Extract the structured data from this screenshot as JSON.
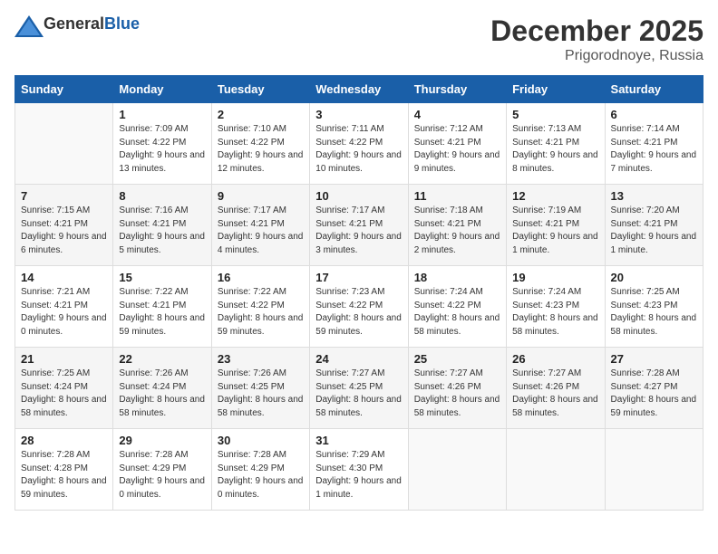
{
  "header": {
    "logo_general": "General",
    "logo_blue": "Blue",
    "month": "December 2025",
    "location": "Prigorodnoye, Russia"
  },
  "weekdays": [
    "Sunday",
    "Monday",
    "Tuesday",
    "Wednesday",
    "Thursday",
    "Friday",
    "Saturday"
  ],
  "weeks": [
    [
      {
        "day": "",
        "sunrise": "",
        "sunset": "",
        "daylight": ""
      },
      {
        "day": "1",
        "sunrise": "Sunrise: 7:09 AM",
        "sunset": "Sunset: 4:22 PM",
        "daylight": "Daylight: 9 hours and 13 minutes."
      },
      {
        "day": "2",
        "sunrise": "Sunrise: 7:10 AM",
        "sunset": "Sunset: 4:22 PM",
        "daylight": "Daylight: 9 hours and 12 minutes."
      },
      {
        "day": "3",
        "sunrise": "Sunrise: 7:11 AM",
        "sunset": "Sunset: 4:22 PM",
        "daylight": "Daylight: 9 hours and 10 minutes."
      },
      {
        "day": "4",
        "sunrise": "Sunrise: 7:12 AM",
        "sunset": "Sunset: 4:21 PM",
        "daylight": "Daylight: 9 hours and 9 minutes."
      },
      {
        "day": "5",
        "sunrise": "Sunrise: 7:13 AM",
        "sunset": "Sunset: 4:21 PM",
        "daylight": "Daylight: 9 hours and 8 minutes."
      },
      {
        "day": "6",
        "sunrise": "Sunrise: 7:14 AM",
        "sunset": "Sunset: 4:21 PM",
        "daylight": "Daylight: 9 hours and 7 minutes."
      }
    ],
    [
      {
        "day": "7",
        "sunrise": "Sunrise: 7:15 AM",
        "sunset": "Sunset: 4:21 PM",
        "daylight": "Daylight: 9 hours and 6 minutes."
      },
      {
        "day": "8",
        "sunrise": "Sunrise: 7:16 AM",
        "sunset": "Sunset: 4:21 PM",
        "daylight": "Daylight: 9 hours and 5 minutes."
      },
      {
        "day": "9",
        "sunrise": "Sunrise: 7:17 AM",
        "sunset": "Sunset: 4:21 PM",
        "daylight": "Daylight: 9 hours and 4 minutes."
      },
      {
        "day": "10",
        "sunrise": "Sunrise: 7:17 AM",
        "sunset": "Sunset: 4:21 PM",
        "daylight": "Daylight: 9 hours and 3 minutes."
      },
      {
        "day": "11",
        "sunrise": "Sunrise: 7:18 AM",
        "sunset": "Sunset: 4:21 PM",
        "daylight": "Daylight: 9 hours and 2 minutes."
      },
      {
        "day": "12",
        "sunrise": "Sunrise: 7:19 AM",
        "sunset": "Sunset: 4:21 PM",
        "daylight": "Daylight: 9 hours and 1 minute."
      },
      {
        "day": "13",
        "sunrise": "Sunrise: 7:20 AM",
        "sunset": "Sunset: 4:21 PM",
        "daylight": "Daylight: 9 hours and 1 minute."
      }
    ],
    [
      {
        "day": "14",
        "sunrise": "Sunrise: 7:21 AM",
        "sunset": "Sunset: 4:21 PM",
        "daylight": "Daylight: 9 hours and 0 minutes."
      },
      {
        "day": "15",
        "sunrise": "Sunrise: 7:22 AM",
        "sunset": "Sunset: 4:21 PM",
        "daylight": "Daylight: 8 hours and 59 minutes."
      },
      {
        "day": "16",
        "sunrise": "Sunrise: 7:22 AM",
        "sunset": "Sunset: 4:22 PM",
        "daylight": "Daylight: 8 hours and 59 minutes."
      },
      {
        "day": "17",
        "sunrise": "Sunrise: 7:23 AM",
        "sunset": "Sunset: 4:22 PM",
        "daylight": "Daylight: 8 hours and 59 minutes."
      },
      {
        "day": "18",
        "sunrise": "Sunrise: 7:24 AM",
        "sunset": "Sunset: 4:22 PM",
        "daylight": "Daylight: 8 hours and 58 minutes."
      },
      {
        "day": "19",
        "sunrise": "Sunrise: 7:24 AM",
        "sunset": "Sunset: 4:23 PM",
        "daylight": "Daylight: 8 hours and 58 minutes."
      },
      {
        "day": "20",
        "sunrise": "Sunrise: 7:25 AM",
        "sunset": "Sunset: 4:23 PM",
        "daylight": "Daylight: 8 hours and 58 minutes."
      }
    ],
    [
      {
        "day": "21",
        "sunrise": "Sunrise: 7:25 AM",
        "sunset": "Sunset: 4:24 PM",
        "daylight": "Daylight: 8 hours and 58 minutes."
      },
      {
        "day": "22",
        "sunrise": "Sunrise: 7:26 AM",
        "sunset": "Sunset: 4:24 PM",
        "daylight": "Daylight: 8 hours and 58 minutes."
      },
      {
        "day": "23",
        "sunrise": "Sunrise: 7:26 AM",
        "sunset": "Sunset: 4:25 PM",
        "daylight": "Daylight: 8 hours and 58 minutes."
      },
      {
        "day": "24",
        "sunrise": "Sunrise: 7:27 AM",
        "sunset": "Sunset: 4:25 PM",
        "daylight": "Daylight: 8 hours and 58 minutes."
      },
      {
        "day": "25",
        "sunrise": "Sunrise: 7:27 AM",
        "sunset": "Sunset: 4:26 PM",
        "daylight": "Daylight: 8 hours and 58 minutes."
      },
      {
        "day": "26",
        "sunrise": "Sunrise: 7:27 AM",
        "sunset": "Sunset: 4:26 PM",
        "daylight": "Daylight: 8 hours and 58 minutes."
      },
      {
        "day": "27",
        "sunrise": "Sunrise: 7:28 AM",
        "sunset": "Sunset: 4:27 PM",
        "daylight": "Daylight: 8 hours and 59 minutes."
      }
    ],
    [
      {
        "day": "28",
        "sunrise": "Sunrise: 7:28 AM",
        "sunset": "Sunset: 4:28 PM",
        "daylight": "Daylight: 8 hours and 59 minutes."
      },
      {
        "day": "29",
        "sunrise": "Sunrise: 7:28 AM",
        "sunset": "Sunset: 4:29 PM",
        "daylight": "Daylight: 9 hours and 0 minutes."
      },
      {
        "day": "30",
        "sunrise": "Sunrise: 7:28 AM",
        "sunset": "Sunset: 4:29 PM",
        "daylight": "Daylight: 9 hours and 0 minutes."
      },
      {
        "day": "31",
        "sunrise": "Sunrise: 7:29 AM",
        "sunset": "Sunset: 4:30 PM",
        "daylight": "Daylight: 9 hours and 1 minute."
      },
      {
        "day": "",
        "sunrise": "",
        "sunset": "",
        "daylight": ""
      },
      {
        "day": "",
        "sunrise": "",
        "sunset": "",
        "daylight": ""
      },
      {
        "day": "",
        "sunrise": "",
        "sunset": "",
        "daylight": ""
      }
    ]
  ]
}
